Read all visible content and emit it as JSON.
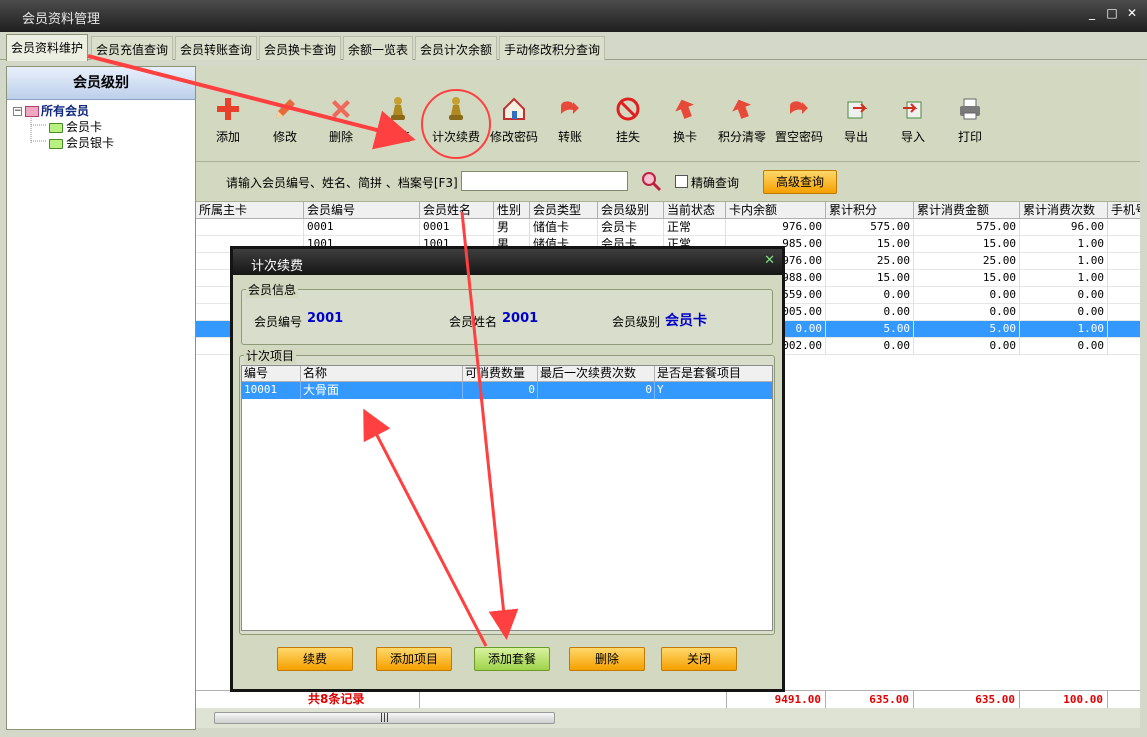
{
  "window": {
    "title": "会员资料管理",
    "controls": [
      "_",
      "□",
      "✕"
    ]
  },
  "tabs": [
    {
      "label": "会员资料维护",
      "active": true
    },
    {
      "label": "会员充值查询",
      "active": false
    },
    {
      "label": "会员转账查询",
      "active": false
    },
    {
      "label": "会员换卡查询",
      "active": false
    },
    {
      "label": "余额一览表",
      "active": false
    },
    {
      "label": "会员计次余额",
      "active": false
    },
    {
      "label": "手动修改积分查询",
      "active": false
    }
  ],
  "sidebar": {
    "header": "会员级别",
    "root": "所有会员",
    "expander": "−",
    "items": [
      "会员卡",
      "会员银卡"
    ]
  },
  "toolbar": {
    "buttons": [
      {
        "label": "添加",
        "icon": "plus-icon"
      },
      {
        "label": "修改",
        "icon": "pencil-icon"
      },
      {
        "label": "删除",
        "icon": "delete-x-icon"
      },
      {
        "label": "充值",
        "icon": "pawn-icon"
      },
      {
        "label": "计次续费",
        "icon": "pawn-icon"
      },
      {
        "label": "修改密码",
        "icon": "house-icon"
      },
      {
        "label": "转账",
        "icon": "transfer-icon"
      },
      {
        "label": "挂失",
        "icon": "no-entry-icon"
      },
      {
        "label": "换卡",
        "icon": "swap-icon"
      },
      {
        "label": "积分清零",
        "icon": "swap-icon"
      },
      {
        "label": "置空密码",
        "icon": "transfer-icon"
      },
      {
        "label": "导出",
        "icon": "export-icon"
      },
      {
        "label": "导入",
        "icon": "import-icon"
      },
      {
        "label": "打印",
        "icon": "printer-icon"
      }
    ]
  },
  "search": {
    "label": "请输入会员编号、姓名、简拼 、档案号[F3]",
    "value": "",
    "exact_label": "精确查询",
    "advanced_label": "高级查询"
  },
  "grid": {
    "columns": [
      "所属主卡",
      "会员编号",
      "会员姓名",
      "性别",
      "会员类型",
      "会员级别",
      "当前状态",
      "卡内余额",
      "累计积分",
      "累计消费金额",
      "累计消费次数",
      "手机号"
    ],
    "rows": [
      [
        "",
        "0001",
        "0001",
        "男",
        "储值卡",
        "会员卡",
        "正常",
        "976.00",
        "575.00",
        "575.00",
        "96.00",
        ""
      ],
      [
        "",
        "1001",
        "1001",
        "男",
        "储值卡",
        "会员卡",
        "正常",
        "985.00",
        "15.00",
        "15.00",
        "1.00",
        ""
      ],
      [
        "",
        "",
        "",
        "",
        "",
        "",
        "",
        "976.00",
        "25.00",
        "25.00",
        "1.00",
        ""
      ],
      [
        "",
        "",
        "",
        "",
        "",
        "",
        "",
        "988.00",
        "15.00",
        "15.00",
        "1.00",
        ""
      ],
      [
        "",
        "",
        "",
        "",
        "",
        "",
        "",
        "559.00",
        "0.00",
        "0.00",
        "0.00",
        ""
      ],
      [
        "",
        "",
        "",
        "",
        "",
        "",
        "",
        "005.00",
        "0.00",
        "0.00",
        "0.00",
        ""
      ],
      [
        "",
        "",
        "",
        "",
        "",
        "",
        "",
        "0.00",
        "5.00",
        "5.00",
        "1.00",
        ""
      ],
      [
        "",
        "",
        "",
        "",
        "",
        "",
        "",
        "002.00",
        "0.00",
        "0.00",
        "0.00",
        ""
      ]
    ],
    "selected_row": 6,
    "footer": {
      "total_label": "共8条记录",
      "balance": "9491.00",
      "points": "635.00",
      "amount": "635.00",
      "count": "100.00"
    },
    "scroll_grip": "|||"
  },
  "dialog": {
    "title": "计次续费",
    "close": "✕",
    "info_group": "会员信息",
    "member_no_label": "会员编号",
    "member_no": "2001",
    "member_name_label": "会员姓名",
    "member_name": "2001",
    "member_level_label": "会员级别",
    "member_level": "会员卡",
    "items_group": "计次项目",
    "columns": [
      "编号",
      "名称",
      "可消费数量",
      "最后一次续费次数",
      "是否是套餐项目"
    ],
    "rows": [
      [
        "10001",
        "大骨面",
        "0",
        "0",
        "Y"
      ]
    ],
    "buttons": [
      "续费",
      "添加项目",
      "添加套餐",
      "删除",
      "关闭"
    ]
  },
  "colors": {
    "accent": "#3399ff",
    "annotation": "#ff4040",
    "button": "#f5a000",
    "total_text": "#e00000",
    "info_value": "#0000c8"
  }
}
